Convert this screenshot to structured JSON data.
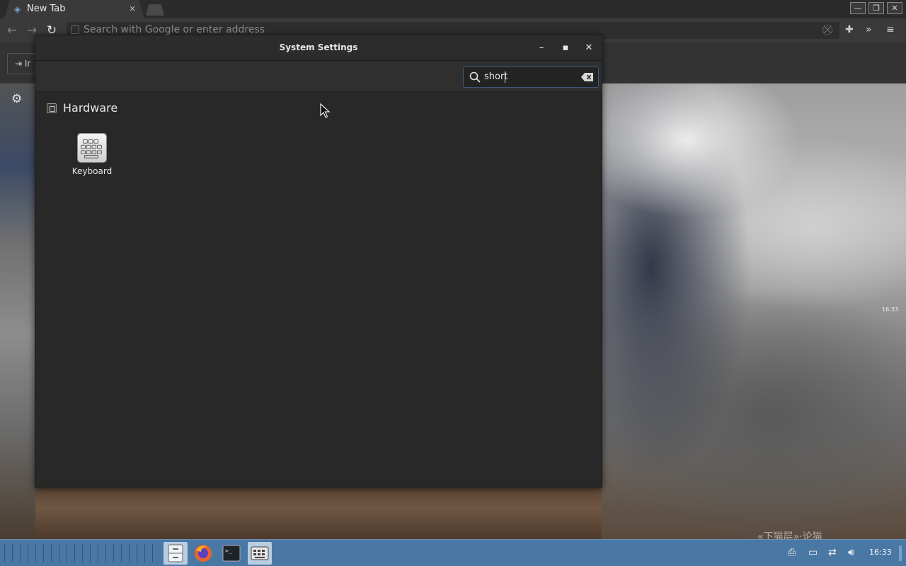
{
  "browser": {
    "tab_title": "New Tab",
    "tab_close": "×",
    "address_placeholder": "Search with Google or enter address",
    "bookmark_label": "Ir",
    "window_controls": {
      "minimize": "—",
      "restore": "❐",
      "close": "✕"
    }
  },
  "settings": {
    "window_title": "System Settings",
    "controls": {
      "minimize": "–",
      "maximize": "▪",
      "close": "✕"
    },
    "search_value": "short",
    "section_title": "Hardware",
    "item_label": "Keyboard"
  },
  "background": {
    "video_time": "16:33",
    "video_caption": "«下猫层»·论猫"
  },
  "taskbar": {
    "clock": "16:33",
    "accent": "#4a78a5"
  }
}
